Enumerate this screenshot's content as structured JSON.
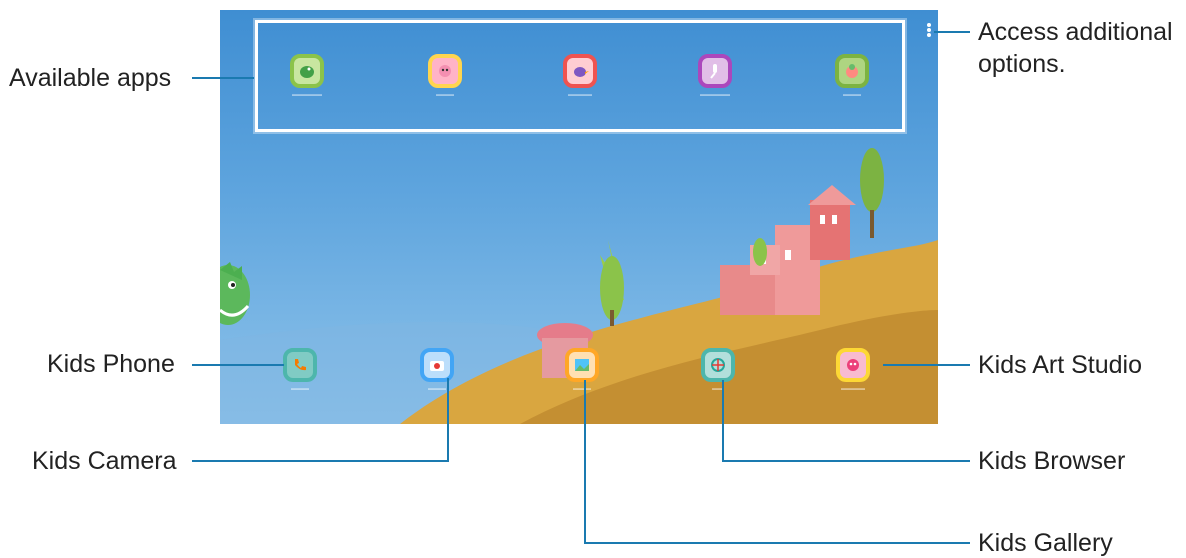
{
  "callouts": {
    "available_apps": "Available apps",
    "access_options_line1": "Access additional",
    "access_options_line2": "options.",
    "kids_phone": "Kids Phone",
    "kids_camera": "Kids Camera",
    "kids_gallery": "Kids Gallery",
    "kids_browser": "Kids Browser",
    "kids_art_studio": "Kids Art Studio"
  },
  "screen": {
    "top_apps": [
      {
        "icon": "dinosaur-icon",
        "color": "#8bc34a"
      },
      {
        "icon": "character-icon",
        "color": "#ffd54f"
      },
      {
        "icon": "bird-icon",
        "color": "#ef5350"
      },
      {
        "icon": "microphone-icon",
        "color": "#ab47bc"
      },
      {
        "icon": "creature-icon",
        "color": "#7cb342"
      }
    ],
    "dock_apps": [
      {
        "name": "Kids Phone",
        "icon": "phone-icon",
        "color": "#4db6ac"
      },
      {
        "name": "Kids Camera",
        "icon": "camera-icon",
        "color": "#42a5f5"
      },
      {
        "name": "Kids Gallery",
        "icon": "gallery-icon",
        "color": "#ffa726"
      },
      {
        "name": "Kids Browser",
        "icon": "browser-icon",
        "color": "#4db6ac"
      },
      {
        "name": "Kids Art Studio",
        "icon": "art-studio-icon",
        "color": "#fdd835"
      }
    ]
  },
  "colors": {
    "sky": "#4a97d8",
    "hill": "#d9a640",
    "castle": "#e88a8a",
    "callout_line": "#1a7ab0"
  }
}
